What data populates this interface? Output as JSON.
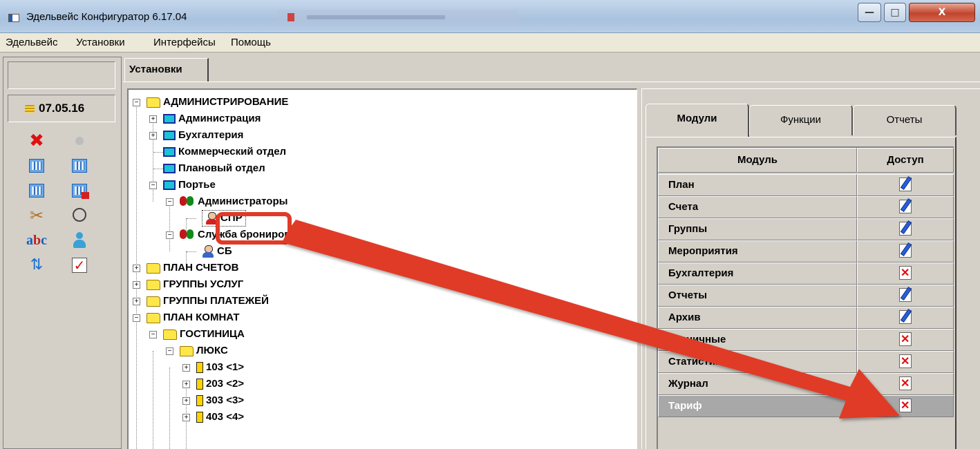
{
  "window": {
    "title": "Эдельвейс Конфигуратор 6.17.04",
    "controls": {
      "minimize": "—",
      "maximize": "□",
      "close": "X"
    }
  },
  "menu": [
    "Эдельвейс",
    "Установки",
    "Интерфейсы",
    "Помощь"
  ],
  "left_panel": {
    "date": "07.05.16",
    "icons": [
      "close-icon",
      "status-dot-icon",
      "grid-icon",
      "grid-add-icon",
      "grid-icon",
      "grid-delete-icon",
      "tools-icon",
      "clock-icon",
      "spellcheck-icon",
      "user-money-icon",
      "sync-icon",
      "checklist-icon"
    ]
  },
  "main_tab": "Установки",
  "tree": [
    {
      "label": "АДМИНИСТРИРОВАНИЕ",
      "icon": "folder-icon",
      "expander": "−"
    },
    {
      "label": "Администрация",
      "icon": "monitor-icon",
      "expander": "+"
    },
    {
      "label": "Бухгалтерия",
      "icon": "monitor-icon",
      "expander": "+"
    },
    {
      "label": "Коммерческий отдел",
      "icon": "monitor-icon",
      "expander": ""
    },
    {
      "label": "Плановый отдел",
      "icon": "monitor-icon",
      "expander": ""
    },
    {
      "label": "Портье",
      "icon": "monitor-icon",
      "expander": "−"
    },
    {
      "label": "Администраторы",
      "icon": "group-icon",
      "expander": "−"
    },
    {
      "label": "СПР",
      "icon": "user-icon",
      "expander": ""
    },
    {
      "label": "Служба бронирования",
      "icon": "group-icon",
      "expander": "−"
    },
    {
      "label": "СБ",
      "icon": "user-icon",
      "expander": ""
    },
    {
      "label": "ПЛАН СЧЕТОВ",
      "icon": "folder-icon",
      "expander": "+"
    },
    {
      "label": "ГРУППЫ УСЛУГ",
      "icon": "folder-icon",
      "expander": "+"
    },
    {
      "label": "ГРУППЫ ПЛАТЕЖЕЙ",
      "icon": "folder-icon",
      "expander": "+"
    },
    {
      "label": "ПЛАН КОМНАТ",
      "icon": "folder-icon",
      "expander": "−"
    },
    {
      "label": "ГОСТИНИЦА",
      "icon": "folder-icon",
      "expander": "−"
    },
    {
      "label": "ЛЮКС",
      "icon": "folder-icon",
      "expander": "−"
    },
    {
      "label": "103  <1>",
      "icon": "door-icon",
      "expander": "+"
    },
    {
      "label": "203  <2>",
      "icon": "door-icon",
      "expander": "+"
    },
    {
      "label": "303   <3>",
      "icon": "door-icon",
      "expander": "+"
    },
    {
      "label": "403  <4>",
      "icon": "door-icon",
      "expander": "+"
    }
  ],
  "right_tabs": [
    "Модули",
    "Функции",
    "Отчеты"
  ],
  "modules_table": {
    "headers": [
      "Модуль",
      "Доступ"
    ],
    "rows": [
      {
        "name": "План",
        "access": "edit-icon"
      },
      {
        "name": "Счета",
        "access": "edit-icon"
      },
      {
        "name": "Группы",
        "access": "edit-icon"
      },
      {
        "name": "Мероприятия",
        "access": "edit-icon"
      },
      {
        "name": "Бухгалтерия",
        "access": "deny-icon"
      },
      {
        "name": "Отчеты",
        "access": "edit-icon"
      },
      {
        "name": "Архив",
        "access": "edit-icon"
      },
      {
        "name": "Горничные",
        "access": "deny-icon"
      },
      {
        "name": "Статистика",
        "access": "deny-icon"
      },
      {
        "name": "Журнал",
        "access": "deny-icon"
      },
      {
        "name": "Тариф",
        "access": "deny-icon"
      }
    ],
    "selected_row": "Тариф"
  },
  "colors": {
    "annotation": "#e03a28",
    "selection": "#a8a8a8"
  }
}
